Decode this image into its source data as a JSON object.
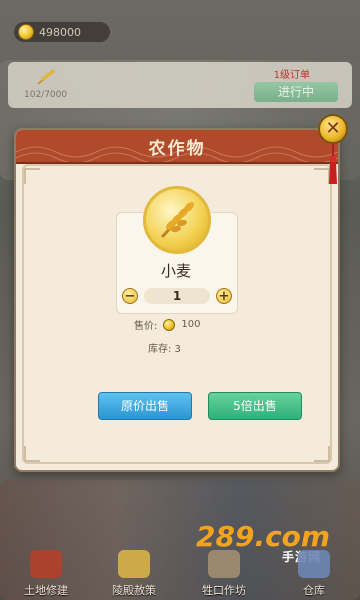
{
  "top_bar": {
    "coins": "498000"
  },
  "order": {
    "progress": "102/7000",
    "level_label": "1级订单",
    "status": "进行中"
  },
  "modal": {
    "title": "农作物",
    "item_name": "小麦",
    "quantity": "1",
    "minus": "−",
    "plus": "+",
    "price_label": "售价:",
    "price_value": "100",
    "stock_label": "库存: 3",
    "sell_original": "原价出售",
    "sell_5x": "5倍出售",
    "close": "✕"
  },
  "bottom_nav": {
    "items": [
      {
        "label": "土地修建"
      },
      {
        "label": "陵殿赦策"
      },
      {
        "label": "牲口作坊"
      },
      {
        "label": "仓库"
      }
    ]
  },
  "watermark": {
    "logo": "289.com",
    "sub": "手游网"
  },
  "colors": {
    "header_red": "#b04a2a",
    "sell_original_blue": "#2c95d1",
    "sell_5x_green": "#2fb07a",
    "gold": "#e9b525"
  },
  "icons": [
    "coin-icon",
    "wheat-icon",
    "close-icon"
  ]
}
